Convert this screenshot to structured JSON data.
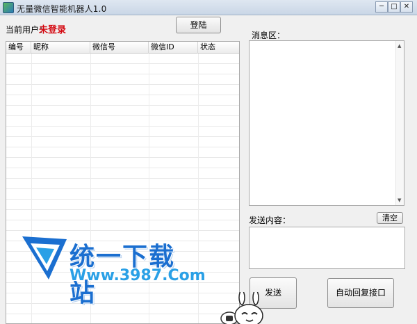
{
  "window": {
    "title": "无量微信智能机器人1.0",
    "min": "─",
    "max": "□",
    "close": "✕"
  },
  "user": {
    "label": "当前用户：",
    "status": "未登录"
  },
  "buttons": {
    "login": "登陆",
    "clear": "清空",
    "send": "发送",
    "auto_reply": "自动回复接口"
  },
  "grid": {
    "columns": [
      "编号",
      "昵称",
      "微信号",
      "微信ID",
      "状态"
    ]
  },
  "messages": {
    "label": "消息区：",
    "scroll_up": "▲",
    "scroll_down": "▼"
  },
  "send_area": {
    "label": "发送内容："
  },
  "watermark": {
    "name": "统一下载站",
    "url": "Www.3987.Com"
  },
  "colors": {
    "status_red": "#d4070f",
    "watermark_blue": "#1b6fd0"
  }
}
